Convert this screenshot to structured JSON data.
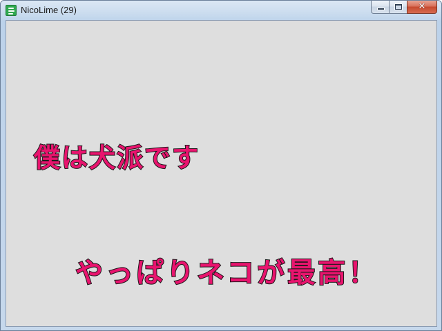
{
  "window": {
    "title": "NicoLime (29)",
    "icon": "nicolime-app-icon",
    "caption_buttons": {
      "minimize_icon": "minimize-icon",
      "maximize_icon": "maximize-icon",
      "close_label": "✕"
    }
  },
  "comments": [
    {
      "text": "僕は犬派です"
    },
    {
      "text": "やっぱりネコが最高！"
    }
  ],
  "colors": {
    "comment_fill": "#e8146e",
    "comment_outline": "#1a1a1a",
    "client_background": "#dedede"
  }
}
